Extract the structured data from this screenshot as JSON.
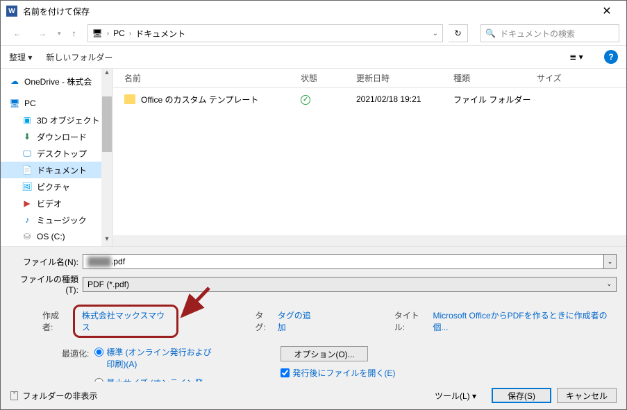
{
  "window": {
    "title": "名前を付けて保存",
    "close": "✕"
  },
  "nav": {
    "back": "←",
    "forward": "→",
    "up": "↑",
    "crumb_pc": "PC",
    "crumb_doc": "ドキュメント",
    "refresh": "↻",
    "search_placeholder": "ドキュメントの検索"
  },
  "toolbar": {
    "organize": "整理 ▾",
    "new_folder": "新しいフォルダー",
    "view": "≣ ▾",
    "help": "?"
  },
  "tree": {
    "items": [
      {
        "icon": "onedrive",
        "label": "OneDrive - 株式会"
      },
      {
        "icon": "pc",
        "label": "PC"
      },
      {
        "icon": "3d",
        "label": "3D オブジェクト",
        "sub": true
      },
      {
        "icon": "dl",
        "label": "ダウンロード",
        "sub": true
      },
      {
        "icon": "desktop",
        "label": "デスクトップ",
        "sub": true
      },
      {
        "icon": "doc",
        "label": "ドキュメント",
        "sub": true,
        "selected": true
      },
      {
        "icon": "pic",
        "label": "ピクチャ",
        "sub": true
      },
      {
        "icon": "vid",
        "label": "ビデオ",
        "sub": true
      },
      {
        "icon": "music",
        "label": "ミュージック",
        "sub": true
      },
      {
        "icon": "drive",
        "label": "OS (C:)",
        "sub": true
      }
    ]
  },
  "list": {
    "cols": {
      "name": "名前",
      "state": "状態",
      "date": "更新日時",
      "type": "種類",
      "size": "サイズ"
    },
    "rows": [
      {
        "name": "Office のカスタム テンプレート",
        "state": "✓",
        "date": "2021/02/18 19:21",
        "type": "ファイル フォルダー",
        "size": ""
      }
    ]
  },
  "form": {
    "filename_label": "ファイル名(N):",
    "filename_blur": "████",
    "filename_ext": ".pdf",
    "type_label": "ファイルの種類(T):",
    "type_value": "PDF (*.pdf)"
  },
  "meta": {
    "author_label": "作成者:",
    "author_value": "株式会社マックスマウス",
    "tag_label": "タグ:",
    "tag_value": "タグの追加",
    "title_label": "タイトル:",
    "title_value": "Microsoft OfficeからPDFを作るときに作成者の個..."
  },
  "optimize": {
    "label": "最適化:",
    "r1": "標準 (オンライン発行および印刷)(A)",
    "r2": "最小サイズ (オンライン発行)(M)",
    "options_btn": "オプション(O)...",
    "open_after": "発行後にファイルを開く(E)"
  },
  "footer": {
    "hide": "フォルダーの非表示",
    "tools": "ツール(L) ▾",
    "save": "保存(S)",
    "cancel": "キャンセル"
  }
}
